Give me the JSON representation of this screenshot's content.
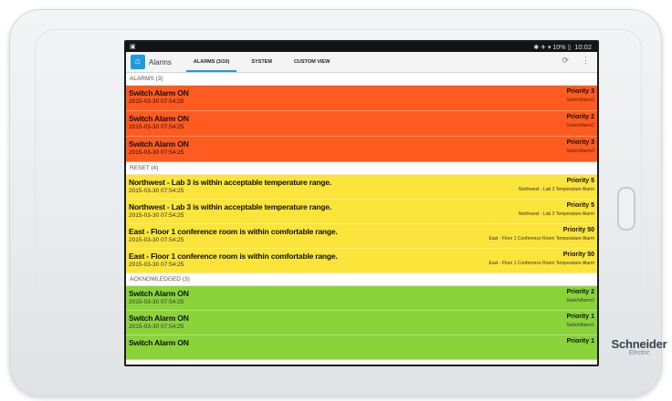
{
  "statusbar": {
    "right_text": "✱ ✈ ▾ 10% ▯",
    "time": "10:02"
  },
  "appbar": {
    "title": "Alarms",
    "tabs": [
      "ALARMS (3/10)",
      "SYSTEM",
      "CUSTOM VIEW"
    ],
    "refresh_glyph": "⟳",
    "overflow_glyph": "⋮"
  },
  "sections": {
    "alarms": "ALARMS (3)",
    "reset": "RESET (4)",
    "acknowledged": "ACKNOWLEDGED (3)"
  },
  "alarms": [
    {
      "title": "Switch Alarm ON",
      "date": "2015-03-30 07:54:25",
      "priority": "Priority 3",
      "source": "SwitchAlarm3"
    },
    {
      "title": "Switch Alarm ON",
      "date": "2015-03-30 07:54:25",
      "priority": "Priority 2",
      "source": "SwitchAlarm2"
    },
    {
      "title": "Switch Alarm ON",
      "date": "2015-03-30 07:54:25",
      "priority": "Priority 3",
      "source": "SwitchAlarm3"
    }
  ],
  "reset": [
    {
      "title": "Northwest - Lab 3 is within acceptable temperature range.",
      "date": "2015-03-30 07:54:25",
      "priority": "Priority 5",
      "source": "Northwest - Lab 3 Temperature Alarm"
    },
    {
      "title": "Northwest - Lab 3 is within acceptable temperature range.",
      "date": "2015-03-30 07:54:25",
      "priority": "Priority 5",
      "source": "Northwest - Lab 3 Temperature Alarm"
    },
    {
      "title": "East - Floor 1 conference room is within comfortable range.",
      "date": "2015-03-30 07:54:25",
      "priority": "Priority 50",
      "source": "East - Floor 1 Conference Room Temperature Alarm"
    },
    {
      "title": "East - Floor 1 conference room is within comfortable range.",
      "date": "2015-03-30 07:54:25",
      "priority": "Priority 50",
      "source": "East - Floor 1 Conference Room Temperature Alarm"
    }
  ],
  "acknowledged": [
    {
      "title": "Switch Alarm ON",
      "date": "2015-03-30 07:54:25",
      "priority": "Priority 2",
      "source": "SwitchAlarm2"
    },
    {
      "title": "Switch Alarm ON",
      "date": "2015-03-30 07:54:25",
      "priority": "Priority 1",
      "source": "SwitchAlarm1"
    },
    {
      "title": "Switch Alarm ON",
      "date": "",
      "priority": "Priority 1",
      "source": ""
    }
  ],
  "brand": {
    "name": "Schneider",
    "sub": "Electric"
  },
  "colors": {
    "active_red": "#ff5a1f",
    "reset_yellow": "#fbe53a",
    "ack_green": "#8ad43a",
    "accent_blue": "#1e9be0"
  }
}
